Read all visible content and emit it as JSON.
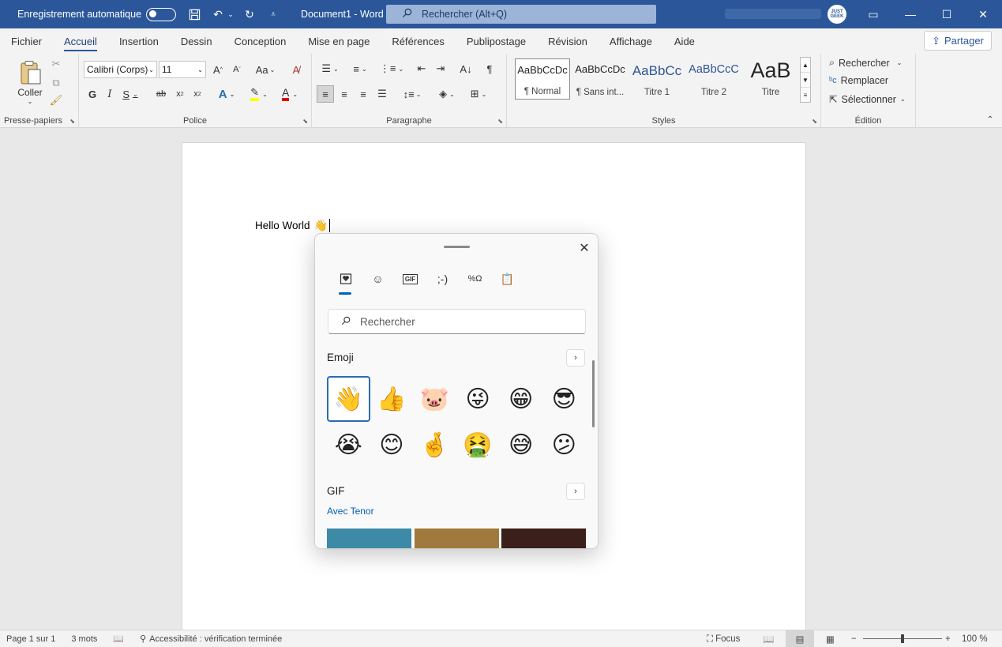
{
  "titlebar": {
    "autosave_label": "Enregistrement automatique",
    "document_title": "Document1  -  Word",
    "search_placeholder": "Rechercher (Alt+Q)",
    "avatar_text": "JUST GEEK"
  },
  "tabs": [
    "Fichier",
    "Accueil",
    "Insertion",
    "Dessin",
    "Conception",
    "Mise en page",
    "Références",
    "Publipostage",
    "Révision",
    "Affichage",
    "Aide"
  ],
  "active_tab": "Accueil",
  "share_label": "Partager",
  "ribbon": {
    "clipboard": {
      "paste_label": "Coller",
      "group_label": "Presse-papiers"
    },
    "font": {
      "font_name": "Calibri (Corps)",
      "font_size": "11",
      "group_label": "Police",
      "case_label": "Aa"
    },
    "paragraph": {
      "group_label": "Paragraphe"
    },
    "styles": {
      "group_label": "Styles",
      "items": [
        {
          "preview": "AaBbCcDc",
          "name": "¶ Normal"
        },
        {
          "preview": "AaBbCcDc",
          "name": "¶ Sans int..."
        },
        {
          "preview": "AaBbCc",
          "name": "Titre 1"
        },
        {
          "preview": "AaBbCcC",
          "name": "Titre 2"
        },
        {
          "preview": "AaB",
          "name": "Titre"
        }
      ]
    },
    "editing": {
      "group_label": "Édition",
      "find": "Rechercher",
      "replace": "Remplacer",
      "select": "Sélectionner"
    }
  },
  "document": {
    "text": "Hello World",
    "emoji": "👋"
  },
  "emoji_panel": {
    "search_placeholder": "Rechercher",
    "emoji_section": "Emoji",
    "gif_section": "GIF",
    "gif_provider": "Avec Tenor",
    "kaomoji_label": ";-)",
    "gif_tab_label": "GIF",
    "emojis": [
      "👋",
      "👍",
      "🐷",
      "😜",
      "😁",
      "😎",
      "😭",
      "😊",
      "🤞",
      "🤮",
      "😅",
      "😕"
    ],
    "gif_colors": [
      "#3d8aa6",
      "#a07a3c",
      "#3a1f1a"
    ]
  },
  "statusbar": {
    "page": "Page 1 sur 1",
    "words": "3 mots",
    "accessibility": "Accessibilité : vérification terminée",
    "focus": "Focus",
    "zoom": "100 %"
  },
  "colors": {
    "accent": "#2b579a",
    "highlight": "#ffff00",
    "font_color": "#e00000"
  }
}
